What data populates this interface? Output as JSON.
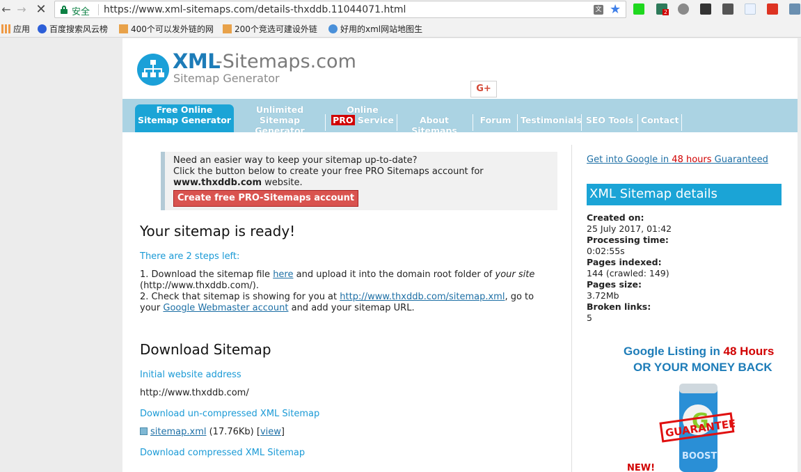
{
  "browser": {
    "secure_label": "安全",
    "url": "https://www.xml-sitemaps.com/details-thxddb.11044071.html",
    "bookmarks": [
      "应用",
      "百度搜索风云榜",
      "400个可以发外链的网",
      "200个竞选可建设外链",
      "好用的xml网站地图生"
    ],
    "ext_badge": "2"
  },
  "site": {
    "logo_xml": "XML",
    "logo_rest": "-Sitemaps.com",
    "logo_sub": "Sitemap Generator",
    "gplus": "G+"
  },
  "nav": {
    "items": [
      {
        "line1": "Free Online",
        "line2": "Sitemap Generator"
      },
      {
        "line1": "Unlimited",
        "line2": "Sitemap Generator"
      },
      {
        "line1": "Online",
        "pro": "PRO",
        "line2": " Service"
      },
      {
        "label": "About Sitemaps"
      },
      {
        "label": "Forum"
      },
      {
        "label": "Testimonials"
      },
      {
        "label": "SEO Tools"
      },
      {
        "label": "Contact"
      }
    ]
  },
  "notice": {
    "line1": "Need an easier way to keep your sitemap up-to-date?",
    "line2": "Click the button below to create your free PRO Sitemaps account for",
    "domain": "www.thxddb.com",
    "suffix": " website.",
    "button": "Create free PRO-Sitemaps account"
  },
  "main": {
    "ready_title": "Your sitemap is ready!",
    "steps_label": "There are 2 steps left:",
    "step1_a": "1. Download the sitemap file ",
    "step1_link": "here",
    "step1_b": " and upload it into the domain root folder of ",
    "step1_em": "your site",
    "step1_c": "(http://www.thxddb.com/).",
    "step2_a": "2. Check that sitemap is showing for you at ",
    "step2_link": "http://www.thxddb.com/sitemap.xml",
    "step2_b": ", go to",
    "step2_c": "your ",
    "step2_link2": "Google Webmaster account",
    "step2_d": " and add your sitemap URL.",
    "download_title": "Download Sitemap",
    "initial_label": "Initial website address",
    "initial_value": "http://www.thxddb.com/",
    "uncompressed_label": "Download un-compressed XML Sitemap",
    "file_link": "sitemap.xml",
    "file_size": " (17.76Kb) [",
    "view_link": "view",
    "file_close": "]",
    "compressed_label": "Download compressed XML Sitemap"
  },
  "side": {
    "guarantee_a": "Get into Google in ",
    "guarantee_hl": "48 hours",
    "guarantee_b": " Guaranteed",
    "details_title": "XML Sitemap details",
    "created_k": "Created on:",
    "created_v": "25 July 2017, 01:42",
    "proc_k": "Processing time:",
    "proc_v": "0:02:55s",
    "indexed_k": "Pages indexed:",
    "indexed_v": "144 (crawled: 149)",
    "size_k": "Pages size:",
    "size_v": "3.72Mb",
    "broken_k": "Broken links:",
    "broken_v": "5",
    "ad_line1_a": "Google Listing in ",
    "ad_line1_hl": "48 Hours",
    "ad_line2": "OR YOUR MONEY BACK",
    "ad_stamp": "GUARANTEED",
    "ad_brand": "BOOST",
    "ad_new": "NEW!"
  }
}
